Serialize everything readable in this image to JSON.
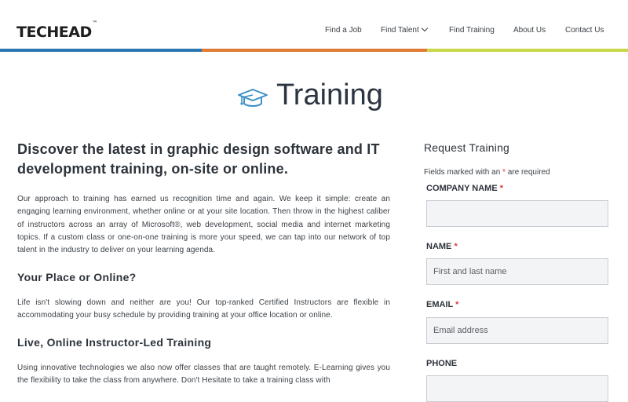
{
  "header": {
    "logo": "TECHEAD",
    "logo_tm": "™",
    "nav": [
      "Find a Job",
      "Find Talent",
      "Find Training",
      "About Us",
      "Contact Us"
    ]
  },
  "hero": {
    "title": "Training",
    "icon": "graduation-cap-icon"
  },
  "main": {
    "lead": "Discover the latest in graphic design software and IT development training, on-site or online.",
    "p1": "Our approach to training has earned us recognition time and again. We keep it simple: create an engaging learning environment, whether online or at your site location. Then throw in the highest caliber of instructors across an array of Microsoft®, web development, social media and internet marketing topics. If a custom class or one-on-one training is more your speed, we can tap into our network of top talent in the industry to deliver on your learning agenda.",
    "h_place": "Your Place or Online?",
    "p2": "Life isn't slowing down and neither are you! Our top-ranked Certified Instructors are flexible in accommodating your busy schedule by providing training at your office location or online.",
    "h_live": "Live, Online Instructor-Led Training",
    "p3": "Using innovative technologies we also now offer classes that are taught remotely. E-Learning gives you the flexibility to take the class from anywhere. Don't Hesitate to take a training class with"
  },
  "form": {
    "title": "Request Training",
    "note_pre": "Fields marked with an",
    "note_star": "*",
    "note_post": "are required",
    "company_label": "COMPANY NAME",
    "name_label": "NAME",
    "name_placeholder": "First and last name",
    "email_label": "EMAIL",
    "email_placeholder": "Email address",
    "phone_label": "PHONE",
    "required_mark": "*"
  },
  "colors": {
    "stripe_blue": "#2a75b0",
    "stripe_orange": "#e07b33",
    "stripe_green": "#c8d647",
    "required": "#e03a3a"
  }
}
